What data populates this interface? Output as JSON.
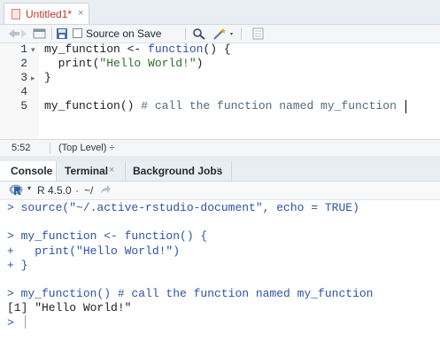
{
  "editor": {
    "tab": {
      "title": "Untitled1*",
      "close": "×"
    },
    "toolbar": {
      "source_on_save": "Source on Save"
    },
    "lines": [
      {
        "n": "1",
        "fold": "▾",
        "tokens": [
          {
            "t": "my_function <- ",
            "c": ""
          },
          {
            "t": "function",
            "c": "fn"
          },
          {
            "t": "() {",
            "c": ""
          }
        ]
      },
      {
        "n": "2",
        "fold": "",
        "tokens": [
          {
            "t": "  print(",
            "c": ""
          },
          {
            "t": "\"Hello World!\"",
            "c": "str"
          },
          {
            "t": ")",
            "c": ""
          }
        ]
      },
      {
        "n": "3",
        "fold": "▸",
        "tokens": [
          {
            "t": "}",
            "c": ""
          }
        ]
      },
      {
        "n": "4",
        "fold": "",
        "tokens": []
      },
      {
        "n": "5",
        "fold": "",
        "tokens": [
          {
            "t": "my_function() ",
            "c": ""
          },
          {
            "t": "# call the function named my_function",
            "c": "cmt"
          }
        ]
      }
    ],
    "status": {
      "position": "5:52",
      "scope": "(Top Level) ÷"
    }
  },
  "console": {
    "tabs": [
      {
        "label": "Console",
        "close": ""
      },
      {
        "label": "Terminal",
        "close": "×"
      },
      {
        "label": "Background Jobs",
        "close": "×"
      }
    ],
    "version": "R 4.5.0",
    "dot": "·",
    "path": "~/",
    "lines": [
      {
        "text": "> source(\"~/.active-rstudio-document\", echo = TRUE)",
        "kind": "in"
      },
      {
        "text": "",
        "kind": "in"
      },
      {
        "text": "> my_function <- function() {",
        "kind": "in"
      },
      {
        "text": "+   print(\"Hello World!\")",
        "kind": "in"
      },
      {
        "text": "+ }",
        "kind": "in"
      },
      {
        "text": "",
        "kind": "in"
      },
      {
        "text": "> my_function() # call the function named my_function",
        "kind": "in"
      },
      {
        "text": "[1] \"Hello World!\"",
        "kind": "out"
      },
      {
        "text": "> ",
        "kind": "in"
      }
    ]
  },
  "colors": {
    "accent": "#2c52a8",
    "string": "#2c6e2c",
    "title_modified": "#c0392b"
  }
}
